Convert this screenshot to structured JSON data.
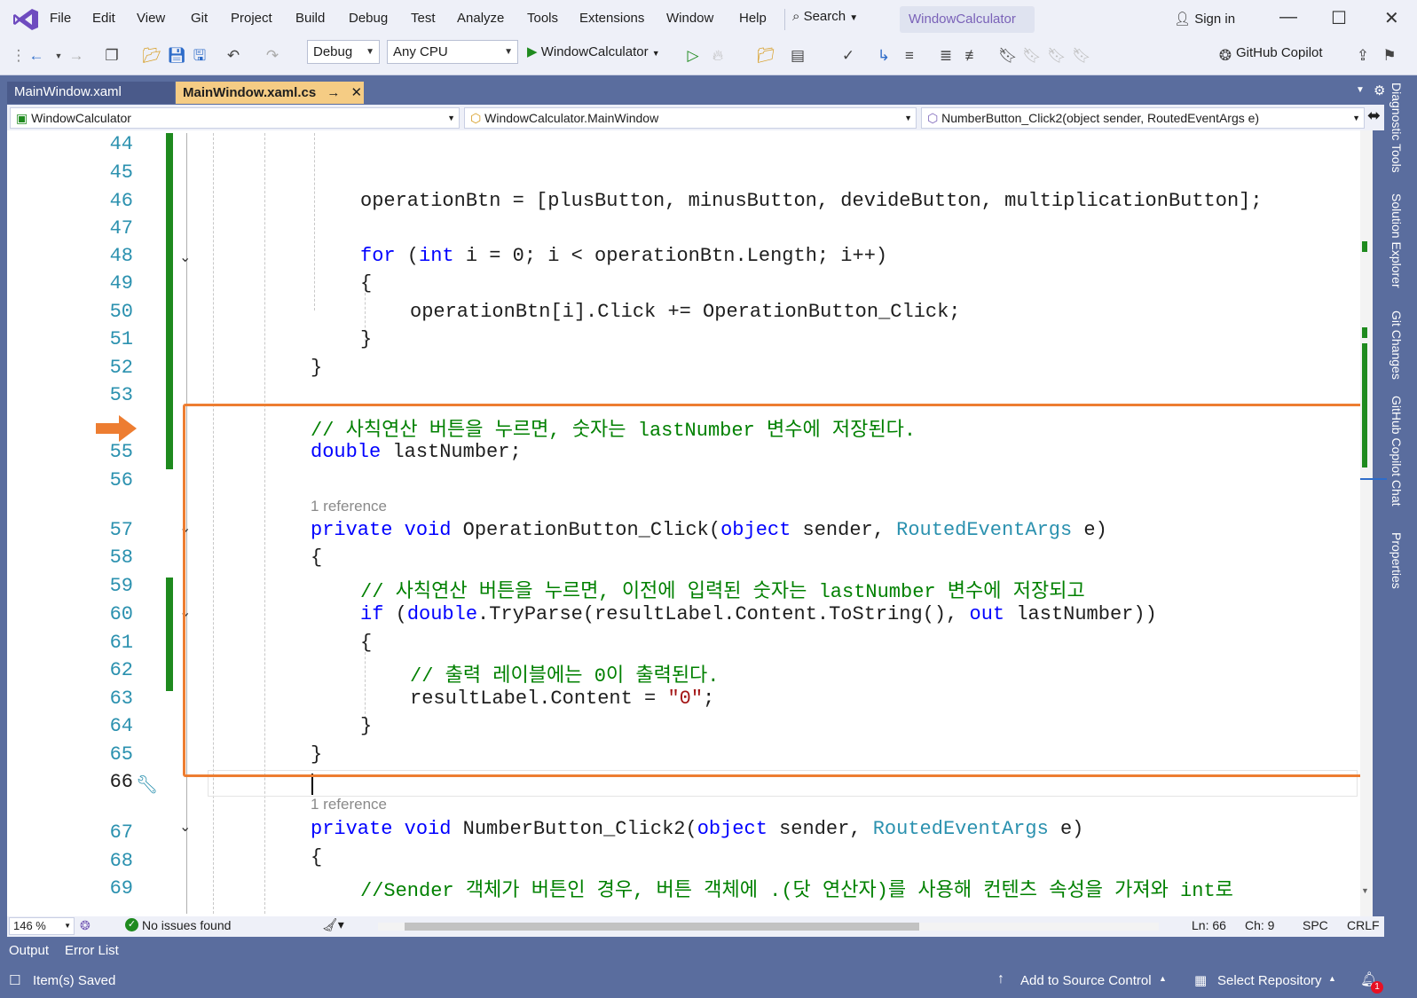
{
  "menu": {
    "items": [
      "File",
      "Edit",
      "View",
      "Git",
      "Project",
      "Build",
      "Debug",
      "Test",
      "Analyze",
      "Tools",
      "Extensions",
      "Window",
      "Help"
    ],
    "search_label": "Search",
    "solution_title": "WindowCalculator",
    "sign_in": "Sign in"
  },
  "toolbar": {
    "config": "Debug",
    "platform": "Any CPU",
    "run_target": "WindowCalculator",
    "copilot": "GitHub Copilot"
  },
  "tabs": [
    {
      "label": "MainWindow.xaml",
      "active": false
    },
    {
      "label": "MainWindow.xaml.cs",
      "active": true
    }
  ],
  "navbar": {
    "project": "WindowCalculator",
    "class": "WindowCalculator.MainWindow",
    "member": "NumberButton_Click2(object sender, RoutedEventArgs e)"
  },
  "side_tabs": [
    "Diagnostic Tools",
    "Solution Explorer",
    "Git Changes",
    "GitHub Copilot Chat",
    "Properties"
  ],
  "editor": {
    "line_numbers": [
      "44",
      "45",
      "46",
      "47",
      "48",
      "49",
      "50",
      "51",
      "52",
      "53",
      "",
      "55",
      "56",
      "57",
      "58",
      "59",
      "60",
      "61",
      "62",
      "63",
      "64",
      "65",
      "66",
      "67",
      "68",
      "69"
    ],
    "reference_labels": [
      "1 reference",
      "1 reference"
    ],
    "code": {
      "l46": "operationBtn = [plusButton, minusButton, devideButton, multiplicationButton];",
      "l48_kw": "for",
      "l48_a": " (",
      "l48_int": "int",
      "l48_b": " i = 0; i < operationBtn.Length; i++)",
      "l49": "{",
      "l50": "operationBtn[i].Click += OperationButton_Click;",
      "l51": "}",
      "l52": "}",
      "l54": "// 사칙연산 버튼을 누르면, 숫자는 lastNumber 변수에 저장된다.",
      "l55_kw": "double",
      "l55_rest": " lastNumber;",
      "l57_kw": "private void",
      "l57_a": " OperationButton_Click(",
      "l57_obj": "object",
      "l57_b": " sender, ",
      "l57_ty": "RoutedEventArgs",
      "l57_c": " e)",
      "l58": "{",
      "l59": "// 사칙연산 버튼을 누르면, 이전에 입력된 숫자는 lastNumber 변수에 저장되고",
      "l60_if": "if",
      "l60_a": " (",
      "l60_dbl": "double",
      "l60_b": ".TryParse(resultLabel.Content.ToString(), ",
      "l60_out": "out",
      "l60_c": " lastNumber))",
      "l61": "{",
      "l62": "// 출력 레이블에는 0이 출력된다.",
      "l63_a": "resultLabel.Content = ",
      "l63_str": "\"0\"",
      "l63_b": ";",
      "l64": "}",
      "l65": "}",
      "l67_kw": "private void",
      "l67_a": " NumberButton_Click2(",
      "l67_obj": "object",
      "l67_b": " sender, ",
      "l67_ty": "RoutedEventArgs",
      "l67_c": " e)",
      "l68": "{",
      "l69": "//Sender 객체가 버튼인 경우, 버튼 객체에 .(닷 연산자)를 사용해 컨텐츠 속성을 가져와 int로"
    }
  },
  "editor_status": {
    "zoom": "146 %",
    "issues": "No issues found",
    "ln": "Ln: 66",
    "ch": "Ch: 9",
    "spc": "SPC",
    "crlf": "CRLF"
  },
  "bottom_tabs": [
    "Output",
    "Error List"
  ],
  "statusbar": {
    "saved": "Item(s) Saved",
    "source_control": "Add to Source Control",
    "repository": "Select Repository",
    "notifications": "1"
  },
  "colors": {
    "accent": "#ed7d31",
    "keyword": "#0000ff",
    "type": "#2b91af",
    "comment": "#008000",
    "string": "#a31515",
    "change_bar": "#1e8a1e"
  }
}
